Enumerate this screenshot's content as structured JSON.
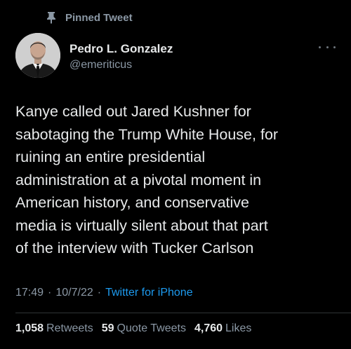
{
  "pinned": {
    "label": "Pinned Tweet",
    "icon": "pin-icon"
  },
  "author": {
    "display_name": "Pedro L. Gonzalez",
    "handle": "@emeriticus",
    "avatar_icon": "avatar"
  },
  "more_icon": "more-options-icon",
  "tweet": {
    "text": "Kanye called out Jared Kushner for\nsabotaging the Trump White House, for\nruining an entire presidential\nadministration at a pivotal moment in\nAmerican history, and conservative\nmedia is virtually silent about that part\nof the interview with Tucker Carlson"
  },
  "meta": {
    "time": "17:49",
    "separator": "·",
    "date": "10/7/22",
    "source": "Twitter for iPhone"
  },
  "stats": {
    "retweets_count": "1,058",
    "retweets_label": "Retweets",
    "quotes_count": "59",
    "quotes_label": "Quote Tweets",
    "likes_count": "4,760",
    "likes_label": "Likes"
  },
  "colors": {
    "background": "#000000",
    "text": "#e7e9ea",
    "secondary": "#8b98a5",
    "accent": "#1d9bf0",
    "divider": "#2f3336"
  }
}
